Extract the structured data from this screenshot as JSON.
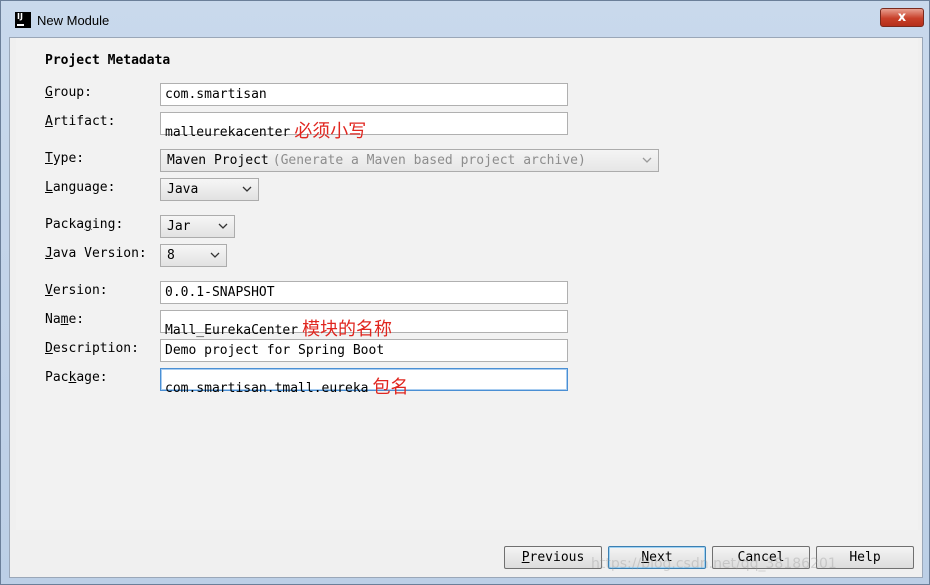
{
  "window": {
    "title": "New Module",
    "app_icon_text": "IJ",
    "close_label": "x"
  },
  "form": {
    "section_title": "Project Metadata",
    "group": {
      "label_pre": "",
      "label_mn": "G",
      "label_post": "roup:",
      "value": "com.smartisan"
    },
    "artifact": {
      "label_pre": "",
      "label_mn": "A",
      "label_post": "rtifact:",
      "value": "malleurekacenter",
      "annotation": "必须小写"
    },
    "type": {
      "label_pre": "",
      "label_mn": "T",
      "label_post": "ype:",
      "value": "Maven Project",
      "hint": "(Generate a Maven based project archive)"
    },
    "language": {
      "label_pre": "",
      "label_mn": "L",
      "label_post": "anguage:",
      "value": "Java"
    },
    "packaging": {
      "label_pre": "Packa",
      "label_mn": "g",
      "label_post": "ing:",
      "value": "Jar"
    },
    "java_version": {
      "label_pre": "",
      "label_mn": "J",
      "label_post": "ava Version:",
      "value": "8"
    },
    "version": {
      "label_pre": "",
      "label_mn": "V",
      "label_post": "ersion:",
      "value": "0.0.1-SNAPSHOT"
    },
    "name": {
      "label_pre": "Na",
      "label_mn": "m",
      "label_post": "e:",
      "value": "Mall_EurekaCenter",
      "annotation": "模块的名称"
    },
    "description": {
      "label_pre": "",
      "label_mn": "D",
      "label_post": "escription:",
      "value": "Demo project for Spring Boot"
    },
    "package": {
      "label_pre": "Pac",
      "label_mn": "k",
      "label_post": "age:",
      "value": "com.smartisan.tmall.eureka",
      "annotation": "包名"
    }
  },
  "buttons": {
    "previous": {
      "mn": "P",
      "rest": "revious"
    },
    "next": {
      "mn": "N",
      "rest": "ext"
    },
    "cancel": "Cancel",
    "help": "Help"
  },
  "watermark": "https://blog.csdn.net/qq_38186201",
  "colors": {
    "annotation": "#e0261f",
    "focus": "#4a8fd4",
    "close": "#c8402a"
  }
}
